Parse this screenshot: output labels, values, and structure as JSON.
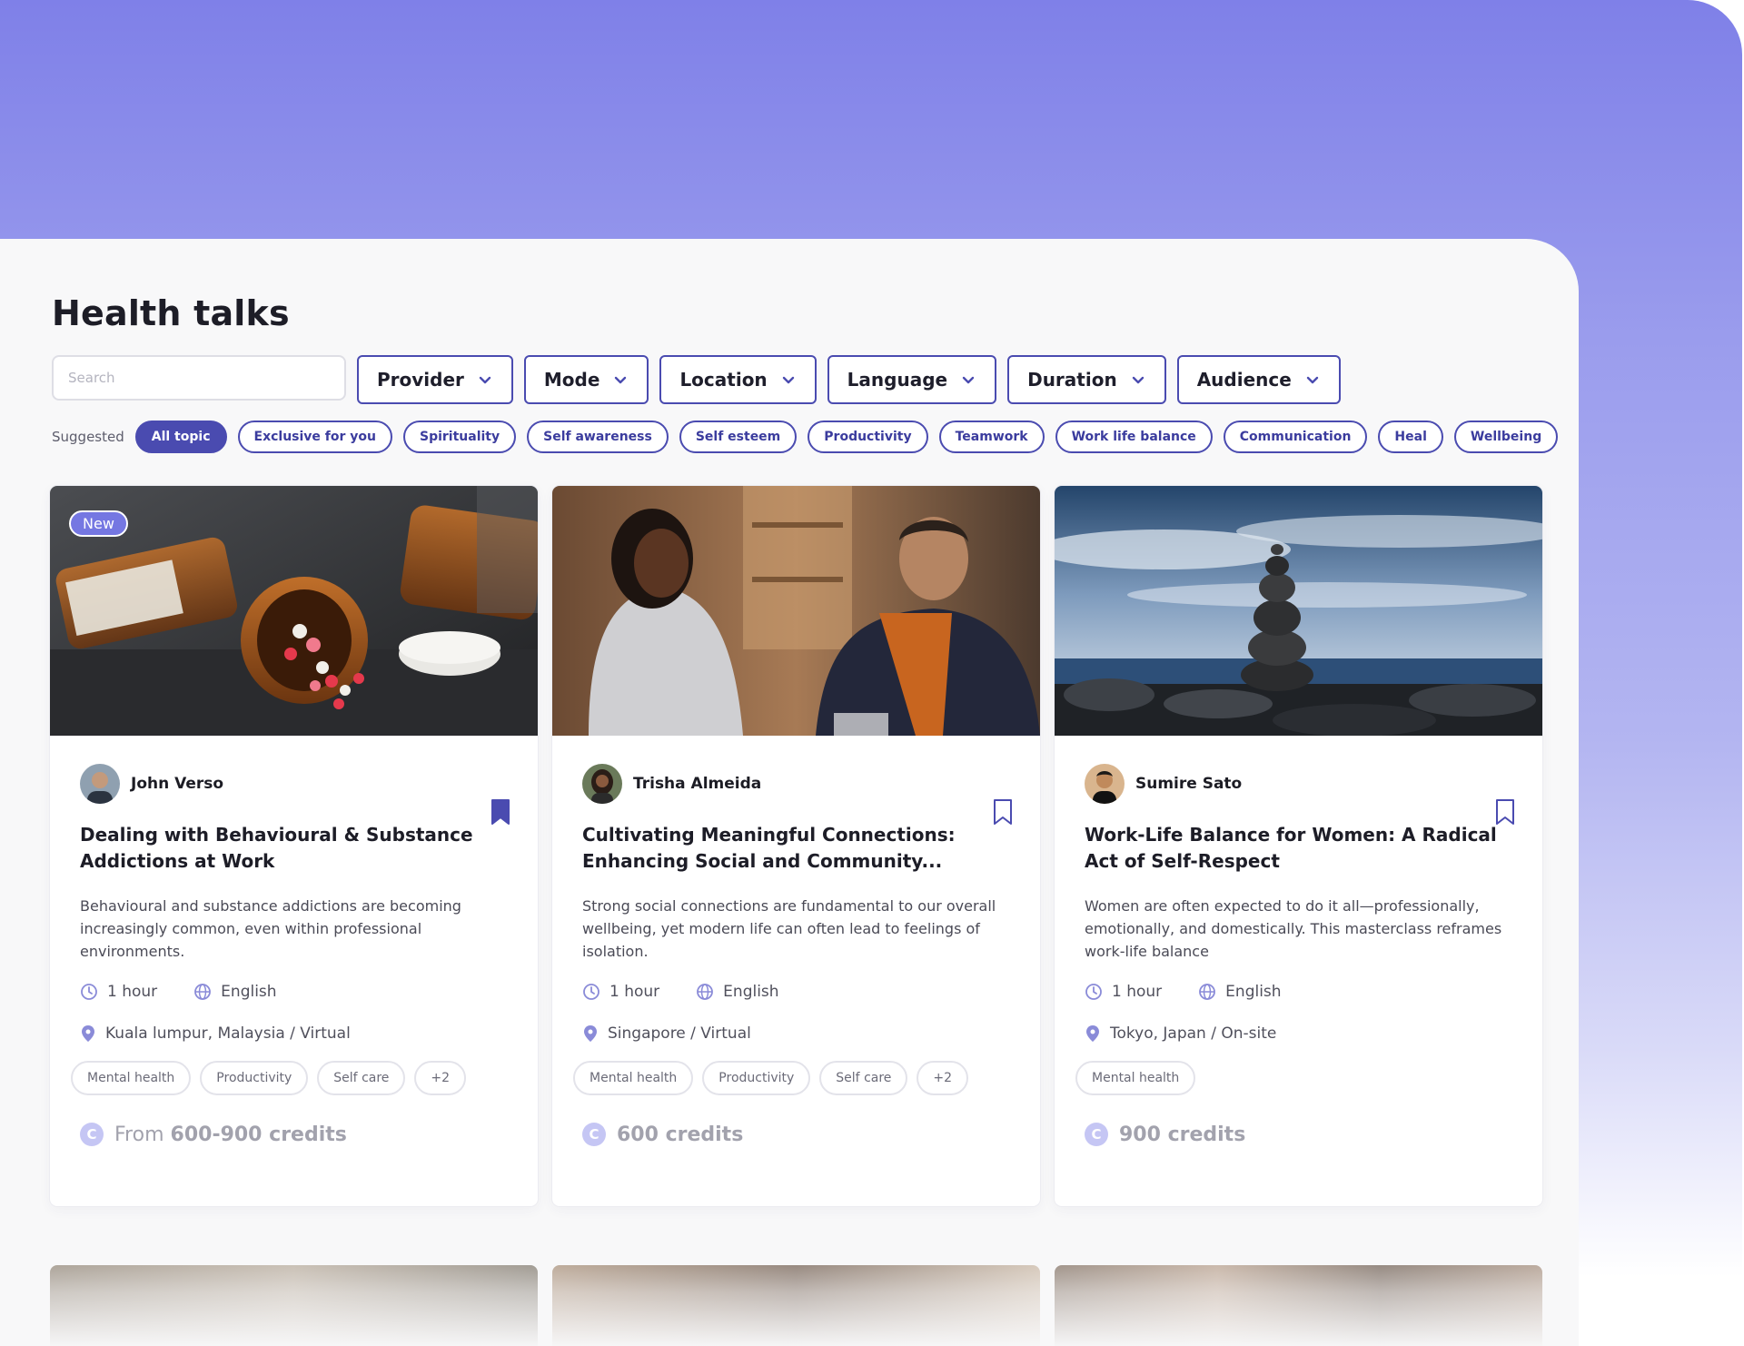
{
  "page": {
    "title": "Health talks"
  },
  "search": {
    "placeholder": "Search"
  },
  "filters": [
    "Provider",
    "Mode",
    "Location",
    "Language",
    "Duration",
    "Audience"
  ],
  "suggested": {
    "label": "Suggested",
    "chips": [
      "All topic",
      "Exclusive for you",
      "Spirituality",
      "Self awareness",
      "Self esteem",
      "Productivity",
      "Teamwork",
      "Work life balance",
      "Communication",
      "Heal",
      "Wellbeing"
    ],
    "active_index": 0
  },
  "cards": [
    {
      "badge": "New",
      "author": "John Verso",
      "bookmarked": true,
      "title": "Dealing with Behavioural & Substance Addictions at Work",
      "description": "Behavioural and substance addictions are becoming increasingly common, even within professional environments.",
      "duration": "1 hour",
      "language": "English",
      "location": "Kuala lumpur, Malaysia / Virtual",
      "tags": [
        "Mental health",
        "Productivity",
        "Self care",
        "+2"
      ],
      "price_prefix": "From ",
      "price": "600-900 credits"
    },
    {
      "badge": "",
      "author": "Trisha Almeida",
      "bookmarked": false,
      "title": "Cultivating Meaningful Connections: Enhancing Social and Community...",
      "description": "Strong social connections are fundamental to our overall wellbeing, yet modern life can often lead to feelings of isolation.",
      "duration": "1 hour",
      "language": "English",
      "location": "Singapore / Virtual",
      "tags": [
        "Mental health",
        "Productivity",
        "Self care",
        "+2"
      ],
      "price_prefix": "",
      "price": "600 credits"
    },
    {
      "badge": "",
      "author": "Sumire Sato",
      "bookmarked": false,
      "title": "Work-Life Balance for Women: A Radical Act of Self-Respect",
      "description": "Women are often expected to do it all—professionally, emotionally, and domestically. This masterclass reframes work-life balance",
      "duration": "1 hour",
      "language": "English",
      "location": "Tokyo, Japan / On-site",
      "tags": [
        "Mental health"
      ],
      "price_prefix": "",
      "price": "900 credits"
    }
  ],
  "colors": {
    "accent": "#4a4bb0",
    "gradient_top": "#7f80e8",
    "coin": "#c5c6f4"
  },
  "icons": {
    "chevron": "chevron-down-icon",
    "clock": "clock-icon",
    "globe": "globe-icon",
    "pin": "map-pin-icon",
    "bookmark": "bookmark-icon",
    "coin": "credit-coin-icon"
  }
}
